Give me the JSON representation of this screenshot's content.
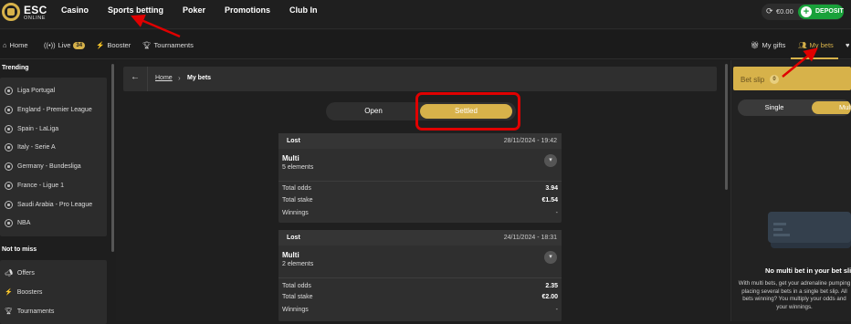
{
  "logo": {
    "name": "ESC",
    "tagline": "ONLINE"
  },
  "topnav": [
    "Casino",
    "Sports betting",
    "Poker",
    "Promotions",
    "Club In"
  ],
  "balance": {
    "amount": "€0.00",
    "deposit_label": "DEPOSIT"
  },
  "subnav": {
    "home": "Home",
    "live": "Live",
    "live_count": "34",
    "booster": "Booster",
    "tournaments": "Tournaments",
    "my_gifts": "My gifts",
    "my_bets": "My bets"
  },
  "sidebar": {
    "trending_title": "Trending",
    "trending": [
      "Liga Portugal",
      "England - Premier League",
      "Spain - LaLiga",
      "Italy - Serie A",
      "Germany - Bundesliga",
      "France - Ligue 1",
      "Saudi Arabia - Pro League",
      "NBA"
    ],
    "not_to_miss_title": "Not to miss",
    "not_to_miss": [
      "Offers",
      "Boosters",
      "Tournaments"
    ]
  },
  "breadcrumb": {
    "home": "Home",
    "current": "My bets"
  },
  "tabs": {
    "open": "Open",
    "settled": "Settled"
  },
  "bets": [
    {
      "status": "Lost",
      "date": "28/11/2024 - 19:42",
      "type": "Multi",
      "elements": "5 elements",
      "total_odds_label": "Total odds",
      "total_odds": "3.94",
      "total_stake_label": "Total stake",
      "total_stake": "€1.54",
      "winnings_label": "Winnings",
      "winnings": "-"
    },
    {
      "status": "Lost",
      "date": "24/11/2024 - 18:31",
      "type": "Multi",
      "elements": "2 elements",
      "total_odds_label": "Total odds",
      "total_odds": "2.35",
      "total_stake_label": "Total stake",
      "total_stake": "€2.00",
      "winnings_label": "Winnings",
      "winnings": "-"
    }
  ],
  "betslip": {
    "title": "Bet slip",
    "count": "0",
    "single": "Single",
    "multi": "Multi",
    "empty_title": "No multi bet in your bet slip",
    "empty_lines": [
      "With multi bets, get your adrenaline pumping",
      "placing several bets in a single bet slip. All",
      "bets winning? You multiply your odds and",
      "your winnings."
    ]
  },
  "colors": {
    "accent": "#d7b24a",
    "deposit": "#19a13a",
    "annotation": "#e00000"
  }
}
